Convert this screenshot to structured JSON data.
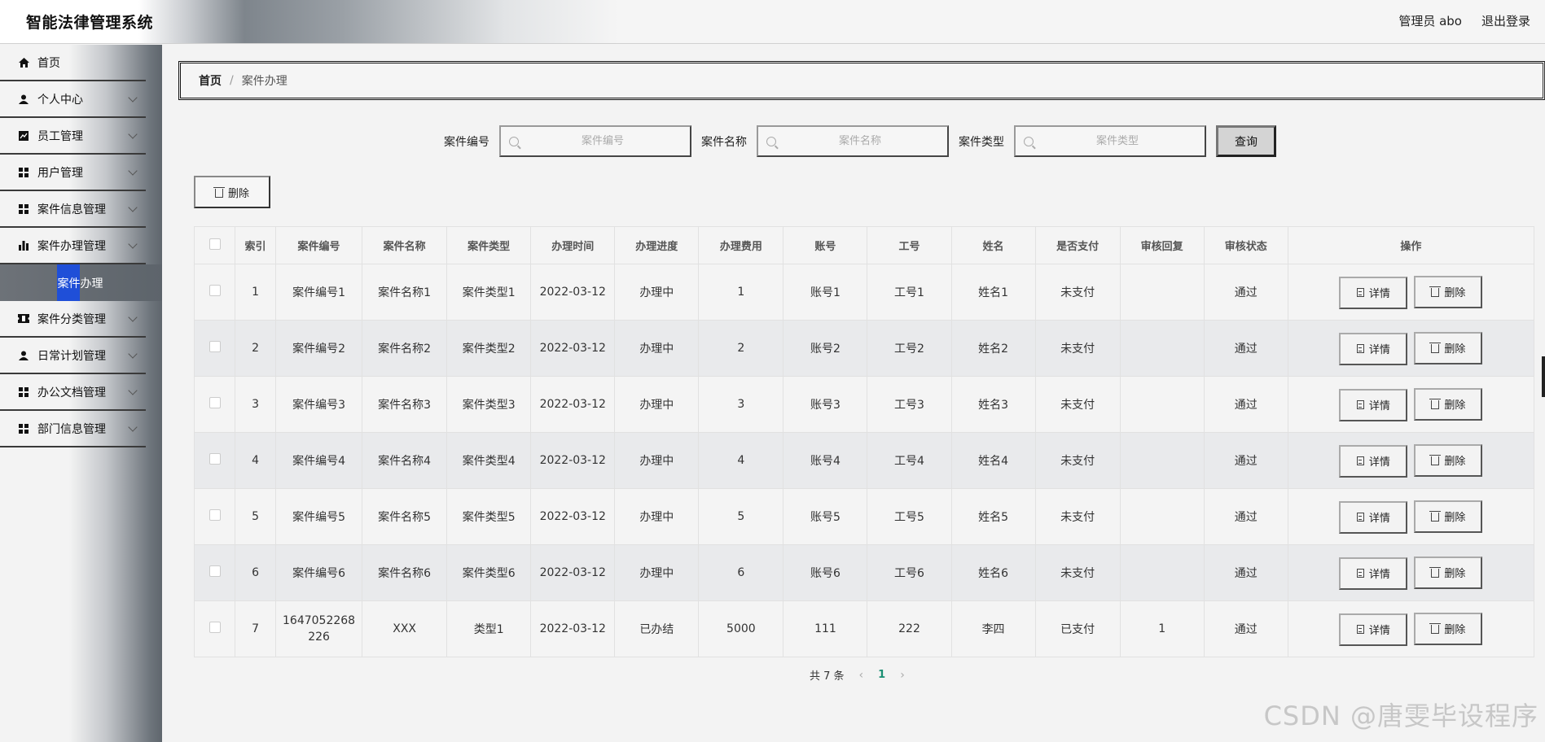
{
  "header": {
    "brand": "智能法律管理系统",
    "user": "管理员 abo",
    "logout": "退出登录"
  },
  "sidebar": {
    "items": [
      {
        "label": "首页",
        "icon": "home-icon",
        "chevron": false
      },
      {
        "label": "个人中心",
        "icon": "user-icon",
        "chevron": true
      },
      {
        "label": "员工管理",
        "icon": "chart-icon",
        "chevron": true
      },
      {
        "label": "用户管理",
        "icon": "grid-icon",
        "chevron": true
      },
      {
        "label": "案件信息管理",
        "icon": "grid-icon",
        "chevron": true
      },
      {
        "label": "案件办理管理",
        "icon": "bar-chart-icon",
        "chevron": true
      }
    ],
    "active_sub": "案件办理",
    "items_after": [
      {
        "label": "案件分类管理",
        "icon": "ticket-icon",
        "chevron": true
      },
      {
        "label": "日常计划管理",
        "icon": "user-icon",
        "chevron": true
      },
      {
        "label": "办公文档管理",
        "icon": "grid-icon",
        "chevron": true
      },
      {
        "label": "部门信息管理",
        "icon": "grid-icon",
        "chevron": true
      }
    ]
  },
  "breadcrumb": {
    "home": "首页",
    "sep": "/",
    "current": "案件办理"
  },
  "search": {
    "case_no_label": "案件编号",
    "case_no_placeholder": "案件编号",
    "case_name_label": "案件名称",
    "case_name_placeholder": "案件名称",
    "case_type_label": "案件类型",
    "case_type_placeholder": "案件类型",
    "query": "查询"
  },
  "batch_delete": "删除",
  "table": {
    "headers": [
      "索引",
      "案件编号",
      "案件名称",
      "案件类型",
      "办理时间",
      "办理进度",
      "办理费用",
      "账号",
      "工号",
      "姓名",
      "是否支付",
      "审核回复",
      "审核状态",
      "操作"
    ],
    "rows": [
      [
        "1",
        "案件编号1",
        "案件名称1",
        "案件类型1",
        "2022-03-12",
        "办理中",
        "1",
        "账号1",
        "工号1",
        "姓名1",
        "未支付",
        "",
        "通过"
      ],
      [
        "2",
        "案件编号2",
        "案件名称2",
        "案件类型2",
        "2022-03-12",
        "办理中",
        "2",
        "账号2",
        "工号2",
        "姓名2",
        "未支付",
        "",
        "通过"
      ],
      [
        "3",
        "案件编号3",
        "案件名称3",
        "案件类型3",
        "2022-03-12",
        "办理中",
        "3",
        "账号3",
        "工号3",
        "姓名3",
        "未支付",
        "",
        "通过"
      ],
      [
        "4",
        "案件编号4",
        "案件名称4",
        "案件类型4",
        "2022-03-12",
        "办理中",
        "4",
        "账号4",
        "工号4",
        "姓名4",
        "未支付",
        "",
        "通过"
      ],
      [
        "5",
        "案件编号5",
        "案件名称5",
        "案件类型5",
        "2022-03-12",
        "办理中",
        "5",
        "账号5",
        "工号5",
        "姓名5",
        "未支付",
        "",
        "通过"
      ],
      [
        "6",
        "案件编号6",
        "案件名称6",
        "案件类型6",
        "2022-03-12",
        "办理中",
        "6",
        "账号6",
        "工号6",
        "姓名6",
        "未支付",
        "",
        "通过"
      ],
      [
        "7",
        "1647052268226",
        "XXX",
        "类型1",
        "2022-03-12",
        "已办结",
        "5000",
        "111",
        "222",
        "李四",
        "已支付",
        "1",
        "通过"
      ]
    ],
    "detail_label": "详情",
    "delete_label": "删除"
  },
  "pager": {
    "total": "共 7 条",
    "prev": "‹",
    "page": "1",
    "next": "›"
  },
  "watermark": "CSDN @唐雯毕设程序"
}
